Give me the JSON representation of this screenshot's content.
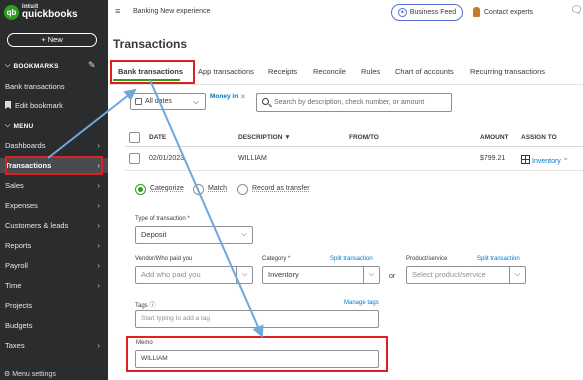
{
  "sidebar": {
    "logo_top": "intuit",
    "logo_bottom": "quickbooks",
    "new_button": "+ New",
    "bookmarks_header": "BOOKMARKS",
    "bookmark_items": [
      "Bank transactions",
      "Edit bookmark"
    ],
    "menu_header": "MENU",
    "menu_items": [
      "Dashboards",
      "Transactions",
      "Sales",
      "Expenses",
      "Customers & leads",
      "Reports",
      "Payroll",
      "Time",
      "Projects",
      "Budgets",
      "Taxes"
    ],
    "active_item": "Transactions",
    "menu_settings": "Menu settings"
  },
  "topbar": {
    "banking_label": "Banking New experience",
    "business_feed": "Business Feed",
    "contact_experts": "Contact experts"
  },
  "page_title": "Transactions",
  "tabs": [
    "Bank transactions",
    "App transactions",
    "Receipts",
    "Reconcile",
    "Rules",
    "Chart of accounts",
    "Recurring transactions"
  ],
  "active_tab": "Bank transactions",
  "filters": {
    "dates": "All dates",
    "money_in": "Money in",
    "search_placeholder": "Search by description, check number, or amount"
  },
  "table": {
    "headers": [
      "DATE",
      "DESCRIPTION ▼",
      "FROM/TO",
      "AMOUNT",
      "ASSIGN TO"
    ],
    "row": {
      "date": "02/01/2023",
      "description": "WILLIAM",
      "amount": "$799.21",
      "assign_to": "Inventory"
    }
  },
  "detail": {
    "radio_options": [
      "Categorize",
      "Match",
      "Record as transfer"
    ],
    "selected_radio": "Categorize",
    "type_label": "Type of transaction *",
    "type_value": "Deposit",
    "vendor_label": "Vendor/Who paid you",
    "vendor_placeholder": "Add who paid you",
    "category_label": "Category *",
    "split_transaction": "Split transaction",
    "category_value": "Inventory",
    "or_text": "or",
    "product_label": "Product/service",
    "product_split": "Split transaction",
    "product_placeholder": "Select product/service",
    "tags_label": "Tags",
    "manage_tags": "Manage tags",
    "tags_placeholder": "Start typing to add a tag",
    "memo_label": "Memo",
    "memo_value": "WILLIAM"
  },
  "colors": {
    "sidebar_bg": "#2b2c2e",
    "accent_green": "#2ca01c",
    "link_blue": "#0077c5",
    "annotation_red": "#e02020",
    "arrow_blue": "#6fa8dc"
  }
}
